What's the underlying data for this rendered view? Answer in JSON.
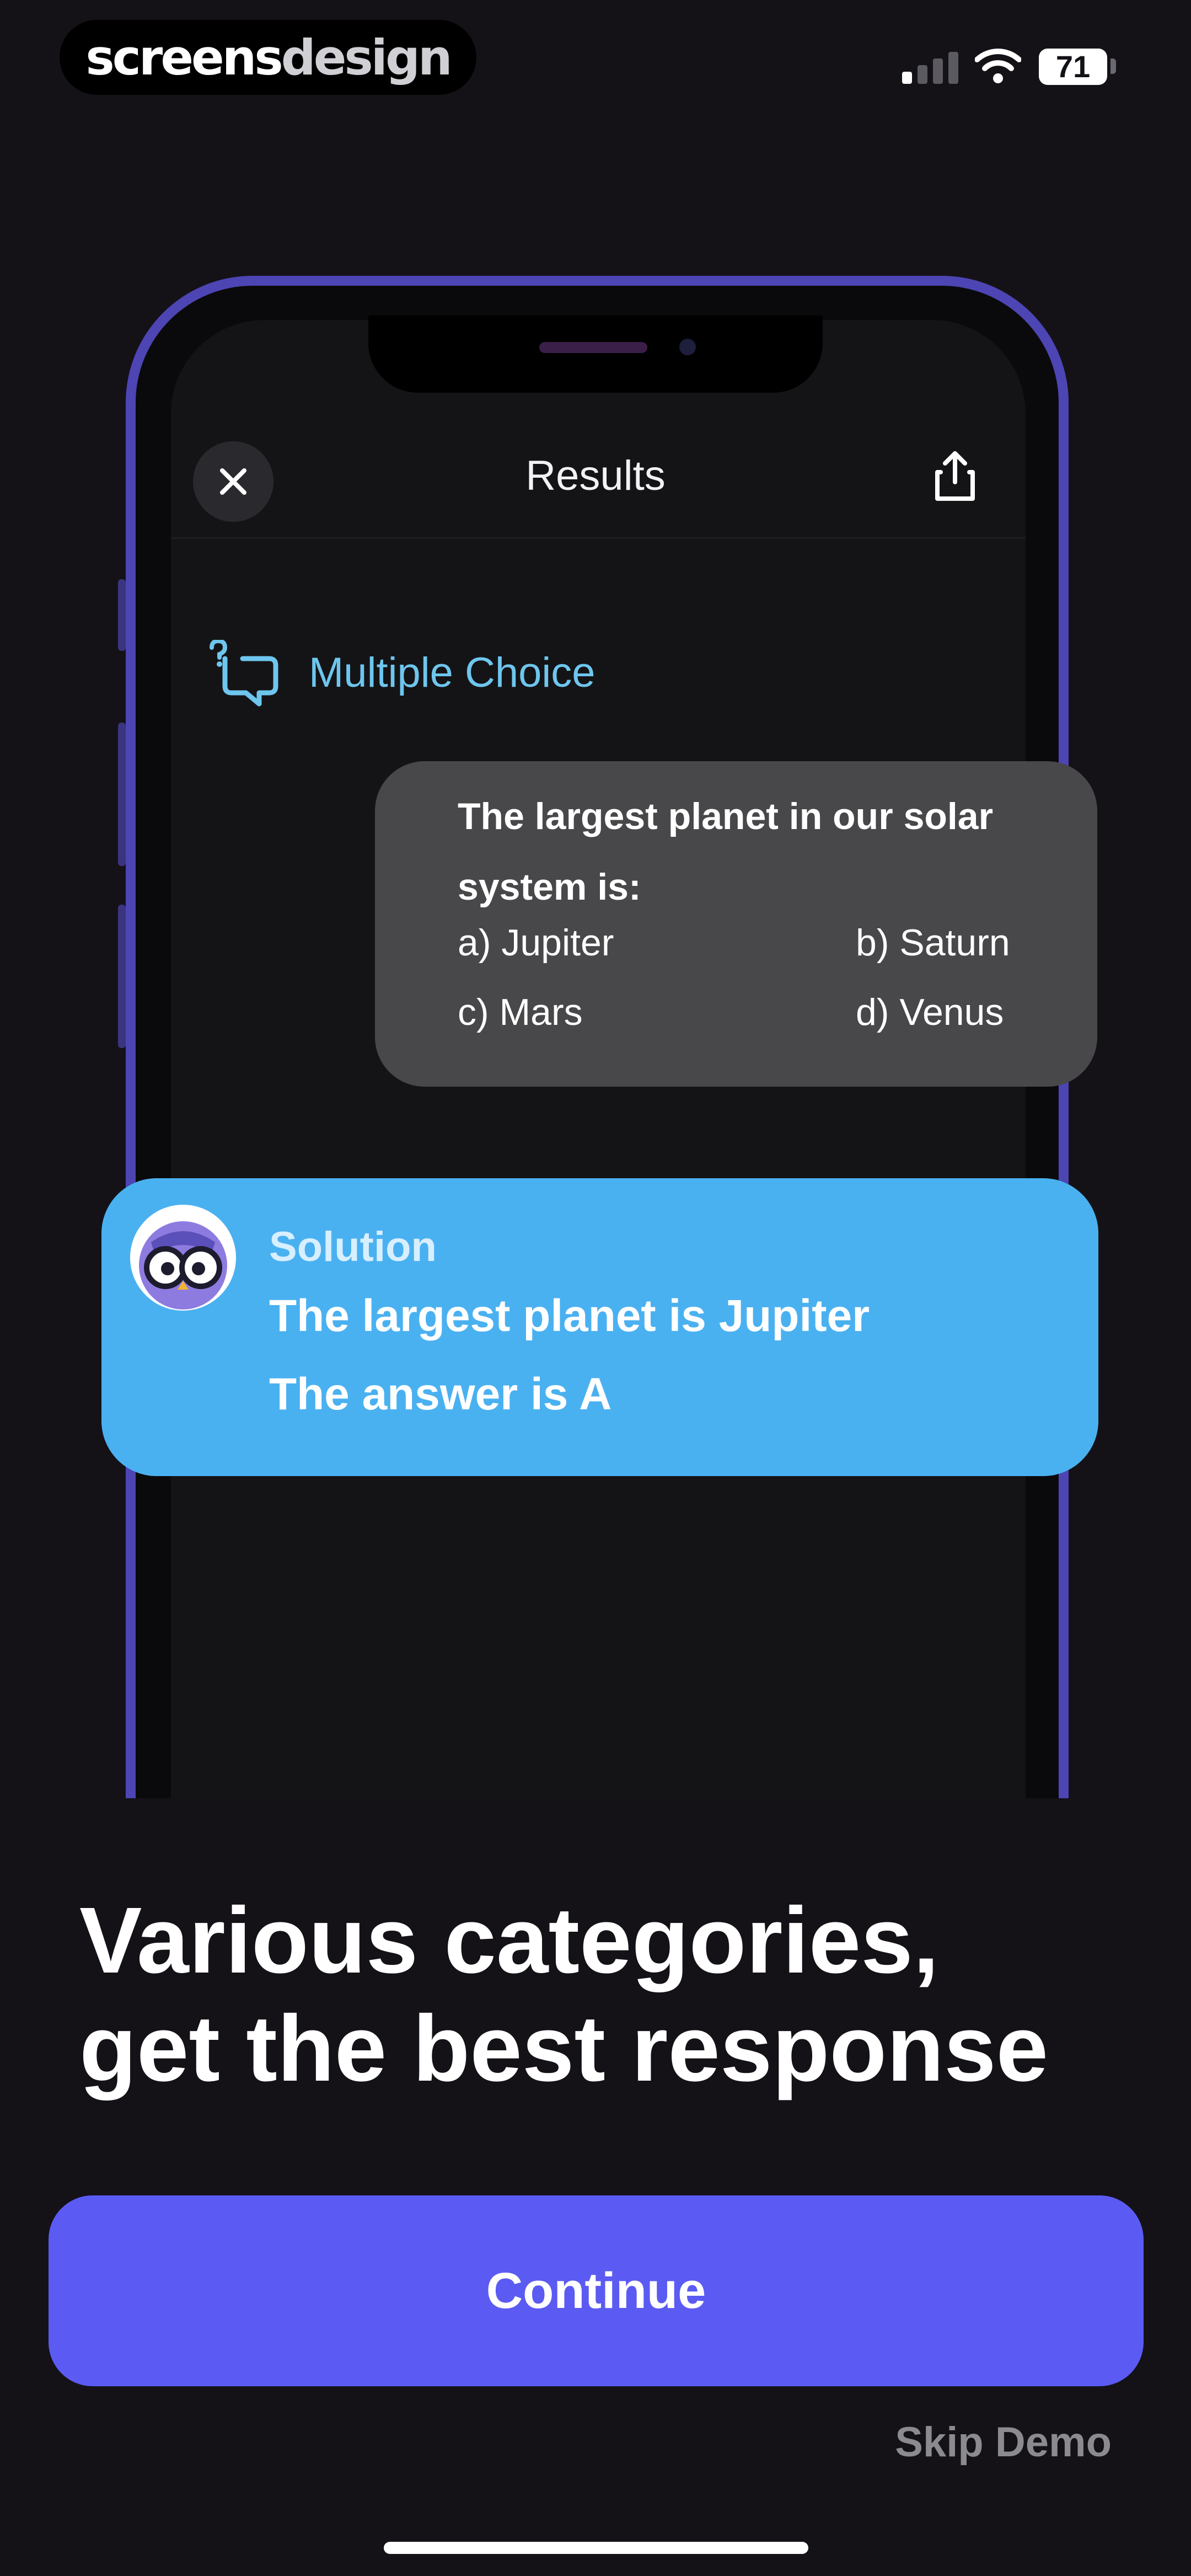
{
  "status_bar": {
    "brand_part1": "screens",
    "brand_part2": "design",
    "battery": "71"
  },
  "mockup": {
    "title": "Results",
    "category": "Multiple Choice",
    "question": {
      "text": "The largest planet in our solar system is:",
      "options": [
        "a) Jupiter",
        "b) Saturn",
        "c) Mars",
        "d) Venus"
      ]
    },
    "solution": {
      "label": "Solution",
      "line1": "The largest planet is Jupiter",
      "line2": "The answer is A"
    }
  },
  "headline": {
    "line1": "Various categories,",
    "line2": "get the best response"
  },
  "actions": {
    "continue_label": "Continue",
    "skip_label": "Skip Demo"
  },
  "colors": {
    "background": "#141217",
    "accent": "#5b5bf3",
    "solution_card": "#4ab1f1",
    "phone_frame": "#4d45b4",
    "category_text": "#6ec6ee"
  },
  "icons": [
    "close-icon",
    "share-icon",
    "question-bubble-icon",
    "owl-avatar-icon",
    "signal-icon",
    "wifi-icon",
    "battery-icon"
  ]
}
